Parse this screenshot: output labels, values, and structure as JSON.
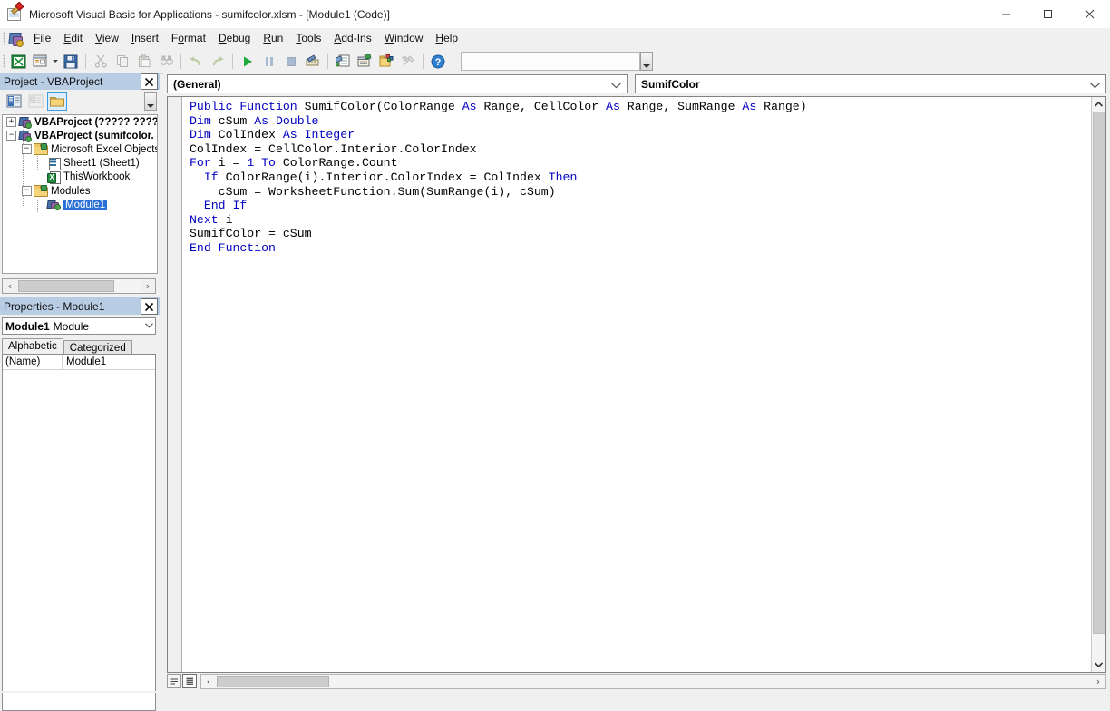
{
  "window": {
    "title": "Microsoft Visual Basic for Applications - sumifcolor.xlsm - [Module1 (Code)]",
    "icon": "vba-excel-icon",
    "controls": {
      "minimize": "minimize-icon",
      "maximize": "maximize-icon",
      "close": "close-icon"
    },
    "mdi_controls": {
      "minimize": "_",
      "restore": "restore-icon",
      "close": "x"
    }
  },
  "menubar": {
    "app_icon": "vba-project-icon",
    "items": [
      {
        "label": "File",
        "accel": "F"
      },
      {
        "label": "Edit",
        "accel": "E"
      },
      {
        "label": "View",
        "accel": "V"
      },
      {
        "label": "Insert",
        "accel": "I"
      },
      {
        "label": "Format",
        "accel": "o"
      },
      {
        "label": "Debug",
        "accel": "D"
      },
      {
        "label": "Run",
        "accel": "R"
      },
      {
        "label": "Tools",
        "accel": "T"
      },
      {
        "label": "Add-Ins",
        "accel": "A"
      },
      {
        "label": "Window",
        "accel": "W"
      },
      {
        "label": "Help",
        "accel": "H"
      }
    ]
  },
  "toolbar": {
    "buttons": [
      {
        "name": "view-excel-button",
        "icon": "excel-icon",
        "enabled": true
      },
      {
        "name": "insert-userform-button",
        "icon": "userform-icon",
        "enabled": true,
        "has_dropdown": true
      },
      {
        "name": "save-button",
        "icon": "save-disk-icon",
        "enabled": true
      },
      {
        "name": "cut-button",
        "icon": "scissors-icon",
        "enabled": false
      },
      {
        "name": "copy-button",
        "icon": "copy-pages-icon",
        "enabled": false
      },
      {
        "name": "paste-button",
        "icon": "clipboard-icon",
        "enabled": false
      },
      {
        "name": "find-button",
        "icon": "binoculars-icon",
        "enabled": false
      },
      {
        "name": "undo-button",
        "icon": "undo-arrow-icon",
        "enabled": false
      },
      {
        "name": "redo-button",
        "icon": "redo-arrow-icon",
        "enabled": false
      },
      {
        "name": "run-button",
        "icon": "play-triangle-icon",
        "enabled": true
      },
      {
        "name": "break-button",
        "icon": "pause-bars-icon",
        "enabled": false
      },
      {
        "name": "reset-button",
        "icon": "stop-square-icon",
        "enabled": false
      },
      {
        "name": "design-mode-button",
        "icon": "design-ruler-icon",
        "enabled": true
      },
      {
        "name": "project-explorer-button",
        "icon": "project-explorer-icon",
        "enabled": true
      },
      {
        "name": "properties-window-button",
        "icon": "properties-window-icon",
        "enabled": true
      },
      {
        "name": "object-browser-button",
        "icon": "object-browser-icon",
        "enabled": true
      },
      {
        "name": "toolbox-button",
        "icon": "toolbox-wrench-icon",
        "enabled": false
      },
      {
        "name": "help-button",
        "icon": "help-question-icon",
        "enabled": true
      }
    ],
    "search_box_value": "",
    "spinner": "spin-down-icon"
  },
  "project_explorer": {
    "title": "Project - VBAProject",
    "close_label": "✕",
    "toolbar": [
      {
        "name": "view-code-button",
        "icon": "view-code-icon",
        "active": false
      },
      {
        "name": "view-object-button",
        "icon": "view-object-icon",
        "active": false
      },
      {
        "name": "toggle-folders-button",
        "icon": "folder-icon",
        "active": true
      }
    ],
    "tree": [
      {
        "label": "VBAProject (????? ????)",
        "icon": "vbaproject-icon",
        "level": 0,
        "expander": "+",
        "bold": true,
        "selected": false
      },
      {
        "label": "VBAProject (sumifcolor.",
        "icon": "vbaproject-icon",
        "level": 0,
        "expander": "-",
        "bold": true,
        "selected": false
      },
      {
        "label": "Microsoft Excel Objects",
        "icon": "folder-icon",
        "level": 1,
        "expander": "-",
        "bold": false,
        "selected": false
      },
      {
        "label": "Sheet1 (Sheet1)",
        "icon": "worksheet-icon",
        "level": 2,
        "expander": "",
        "bold": false,
        "selected": false
      },
      {
        "label": "ThisWorkbook",
        "icon": "workbook-icon",
        "level": 2,
        "expander": "",
        "bold": false,
        "selected": false
      },
      {
        "label": "Modules",
        "icon": "folder-icon",
        "level": 1,
        "expander": "-",
        "bold": false,
        "selected": false
      },
      {
        "label": "Module1",
        "icon": "module-icon",
        "level": 2,
        "expander": "",
        "bold": false,
        "selected": true
      }
    ],
    "hscroll": {
      "left_arrow": "‹",
      "right_arrow": "›"
    }
  },
  "properties": {
    "title": "Properties - Module1",
    "close_label": "✕",
    "object_name": "Module1",
    "object_type": "Module",
    "tabs": [
      {
        "label": "Alphabetic",
        "active": true
      },
      {
        "label": "Categorized",
        "active": false
      }
    ],
    "rows": [
      {
        "name": "(Name)",
        "value": "Module1"
      }
    ]
  },
  "code_window": {
    "object_combo": {
      "value": "(General)",
      "arrow": "chevron-down-icon"
    },
    "procedure_combo": {
      "value": "SumifColor",
      "arrow": "chevron-down-icon"
    },
    "code_lines": [
      [
        {
          "t": "Public Function ",
          "k": true
        },
        {
          "t": "SumifColor(ColorRange "
        },
        {
          "t": "As ",
          "k": true
        },
        {
          "t": "Range, CellColor "
        },
        {
          "t": "As ",
          "k": true
        },
        {
          "t": "Range, SumRange "
        },
        {
          "t": "As ",
          "k": true
        },
        {
          "t": "Range)"
        }
      ],
      [
        {
          "t": "Dim ",
          "k": true
        },
        {
          "t": "cSum "
        },
        {
          "t": "As ",
          "k": true
        },
        {
          "t": "Double",
          "k": true
        }
      ],
      [
        {
          "t": "Dim ",
          "k": true
        },
        {
          "t": "ColIndex "
        },
        {
          "t": "As ",
          "k": true
        },
        {
          "t": "Integer",
          "k": true
        }
      ],
      [
        {
          "t": "ColIndex = CellColor.Interior.ColorIndex"
        }
      ],
      [
        {
          "t": "For ",
          "k": true
        },
        {
          "t": "i = "
        },
        {
          "t": "1 ",
          "k": true
        },
        {
          "t": "To ",
          "k": true
        },
        {
          "t": "ColorRange.Count"
        }
      ],
      [
        {
          "t": "  "
        },
        {
          "t": "If ",
          "k": true
        },
        {
          "t": "ColorRange(i).Interior.ColorIndex = ColIndex "
        },
        {
          "t": "Then",
          "k": true
        }
      ],
      [
        {
          "t": "    cSum = WorksheetFunction.Sum(SumRange(i), cSum)"
        }
      ],
      [
        {
          "t": "  "
        },
        {
          "t": "End If",
          "k": true
        }
      ],
      [
        {
          "t": "Next ",
          "k": true
        },
        {
          "t": "i"
        }
      ],
      [
        {
          "t": "SumifColor = cSum"
        }
      ],
      [
        {
          "t": "End Function",
          "k": true
        }
      ]
    ],
    "vscroll": {
      "up_arrow": "▲",
      "down_arrow": "▼"
    },
    "view_buttons": [
      {
        "name": "procedure-view-button",
        "icon": "procedure-view-icon",
        "active": false
      },
      {
        "name": "full-module-view-button",
        "icon": "full-module-view-icon",
        "active": true
      }
    ],
    "hscroll": {
      "left_arrow": "‹",
      "right_arrow": "›"
    }
  },
  "colors": {
    "keyword": "#0000C0",
    "code_text": "#000000",
    "panel_title_bg": "#b8cce4",
    "selection_bg": "#2a6fd6",
    "window_bg": "#f0f0f0"
  }
}
